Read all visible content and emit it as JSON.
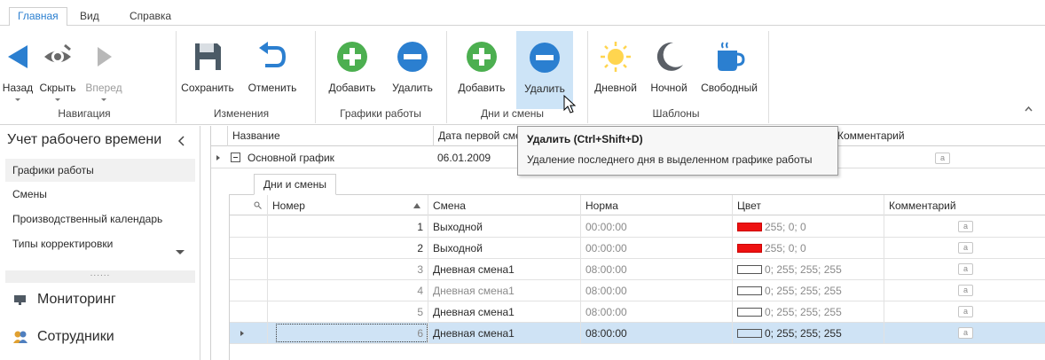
{
  "ribbon": {
    "tabs": [
      {
        "label": "Главная",
        "active": true
      },
      {
        "label": "Вид",
        "active": false
      },
      {
        "label": "Справка",
        "active": false
      }
    ],
    "buttons": {
      "back": {
        "label": "Назад",
        "icon": "arrow-left-icon"
      },
      "hide": {
        "label": "Скрыть",
        "icon": "eye-icon"
      },
      "forward": {
        "label": "Вперед",
        "icon": "arrow-right-icon",
        "disabled": true
      },
      "save": {
        "label": "Сохранить",
        "icon": "save-icon"
      },
      "undo": {
        "label": "Отменить",
        "icon": "undo-icon"
      },
      "schedule_add": {
        "label": "Добавить",
        "icon": "plus-circle-icon"
      },
      "schedule_delete": {
        "label": "Удалить",
        "icon": "minus-circle-icon"
      },
      "day_add": {
        "label": "Добавить",
        "icon": "plus-circle-icon"
      },
      "day_delete": {
        "label": "Удалить",
        "icon": "minus-circle-icon",
        "hovered": true
      },
      "tpl_day": {
        "label": "Дневной",
        "icon": "sun-icon"
      },
      "tpl_night": {
        "label": "Ночной",
        "icon": "moon-icon"
      },
      "tpl_free": {
        "label": "Свободный",
        "icon": "cup-icon"
      }
    },
    "groups": {
      "navigation": "Навигация",
      "changes": "Изменения",
      "schedules": "Графики работы",
      "days": "Дни и смены",
      "templates": "Шаблоны"
    }
  },
  "nav": {
    "title": "Учет рабочего времени",
    "items": [
      {
        "label": "Графики работы",
        "selected": true
      },
      {
        "label": "Смены"
      },
      {
        "label": "Производственный календарь"
      },
      {
        "label": "Типы корректировки"
      }
    ],
    "splitter": "......",
    "groups": [
      {
        "label": "Мониторинг",
        "icon": "monitor-icon"
      },
      {
        "label": "Сотрудники",
        "icon": "employees-icon"
      }
    ]
  },
  "grid": {
    "columns": [
      "Название",
      "Дата первой смены",
      "Комментарий"
    ],
    "row": {
      "name": "Основной график",
      "date": "06.01.2009",
      "comment_icon": "a"
    },
    "detail": {
      "tab": "Дни и смены",
      "columns": [
        "Номер",
        "Смена",
        "Норма",
        "Цвет",
        "Комментарий"
      ],
      "rows": [
        {
          "num": "1",
          "shift": "Выходной",
          "norm": "00:00:00",
          "color": "255; 0; 0",
          "swatch": "#ee1111",
          "comment": "a"
        },
        {
          "num": "2",
          "shift": "Выходной",
          "norm": "00:00:00",
          "color": "255; 0; 0",
          "swatch": "#ee1111",
          "comment": "a"
        },
        {
          "num": "3",
          "shift": "Дневная смена1",
          "norm": "08:00:00",
          "color": "0; 255; 255; 255",
          "swatch": "#ffffff",
          "comment": "a"
        },
        {
          "num": "4",
          "shift": "Дневная смена1",
          "norm": "08:00:00",
          "color": "0; 255; 255; 255",
          "swatch": "#ffffff",
          "comment": "a"
        },
        {
          "num": "5",
          "shift": "Дневная смена1",
          "norm": "08:00:00",
          "color": "0; 255; 255; 255",
          "swatch": "#ffffff",
          "comment": "a"
        },
        {
          "num": "6",
          "shift": "Дневная смена1",
          "norm": "08:00:00",
          "color": "0; 255; 255; 255",
          "swatch": "#ffffff",
          "comment": "a",
          "selected": true
        }
      ]
    }
  },
  "tooltip": {
    "title": "Удалить (Ctrl+Shift+D)",
    "text": "Удаление последнего дня в выделенном графике работы"
  },
  "colors": {
    "accent": "#2b7fd0",
    "hover": "#cde4f7",
    "selected_row": "#cfe3f5"
  }
}
